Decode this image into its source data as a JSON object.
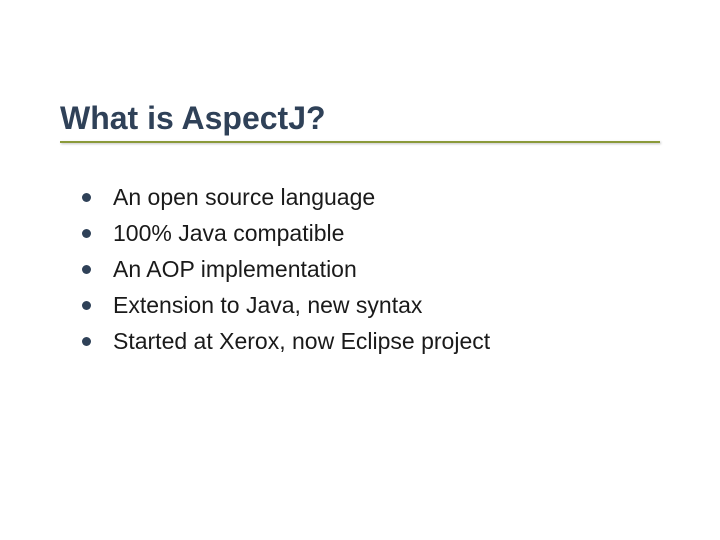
{
  "slide": {
    "title": "What is AspectJ?",
    "bullets": [
      "An open source language",
      "100% Java compatible",
      "An AOP implementation",
      "Extension to Java, new syntax",
      "Started at Xerox, now Eclipse project"
    ]
  }
}
